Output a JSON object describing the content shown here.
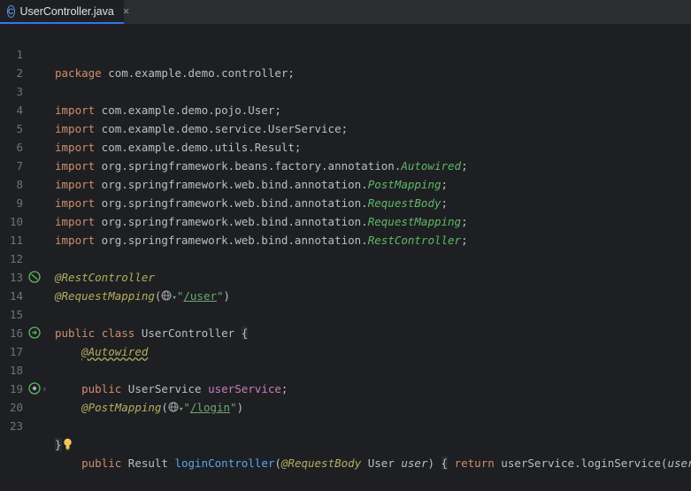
{
  "tab": {
    "label": "UserController.java",
    "icon": "class-c-icon"
  },
  "lines": {
    "n1": "1",
    "n2": "2",
    "n3": "3",
    "n4": "4",
    "n5": "5",
    "n6": "6",
    "n7": "7",
    "n8": "8",
    "n9": "9",
    "n10": "10",
    "n11": "11",
    "n12": "12",
    "n13": "13",
    "n14": "14",
    "n15": "15",
    "n16": "16",
    "n17": "17",
    "n18": "18",
    "n19": "19",
    "n20": "20",
    "n23": "23"
  },
  "code": {
    "kw_package": "package",
    "pkg": " com.example.demo.controller;",
    "kw_import": "import",
    "imp3": " com.example.demo.pojo.User;",
    "imp4": " com.example.demo.service.UserService;",
    "imp5": " com.example.demo.utils.Result;",
    "imp6_pre": " org.springframework.beans.factory.annotation.",
    "imp6_cls": "Autowired",
    "imp7_pre": " org.springframework.web.bind.annotation.",
    "imp7_cls": "PostMapping",
    "imp8_cls": "RequestBody",
    "imp9_cls": "RequestMapping",
    "imp10_cls": "RestController",
    "semi": ";",
    "ann_rest": "@RestController",
    "ann_reqmap": "@RequestMapping",
    "paren_open": "(",
    "paren_close": ")",
    "quote": "\"",
    "path_user": "/user",
    "kw_public": "public",
    "kw_class": "class",
    "class_name": " UserController ",
    "brace_open": "{",
    "brace_close": "}",
    "ann_autowired": "@Autowired",
    "type_userservice": " UserService ",
    "field_userservice": "userService",
    "ann_postmap": "@PostMapping",
    "path_login": "/login",
    "type_result": " Result ",
    "method_name": "loginController",
    "ann_reqbody": "@RequestBody",
    "type_user": " User ",
    "param_user": "user",
    "kw_return": "return",
    "call": " userService.loginService(",
    "end_call": ");"
  },
  "colors": {
    "background": "#1e1f22",
    "keyword": "#cf8e6d",
    "annotation": "#b3ae60",
    "string": "#6aab73",
    "class_ref": "#5fb865"
  }
}
